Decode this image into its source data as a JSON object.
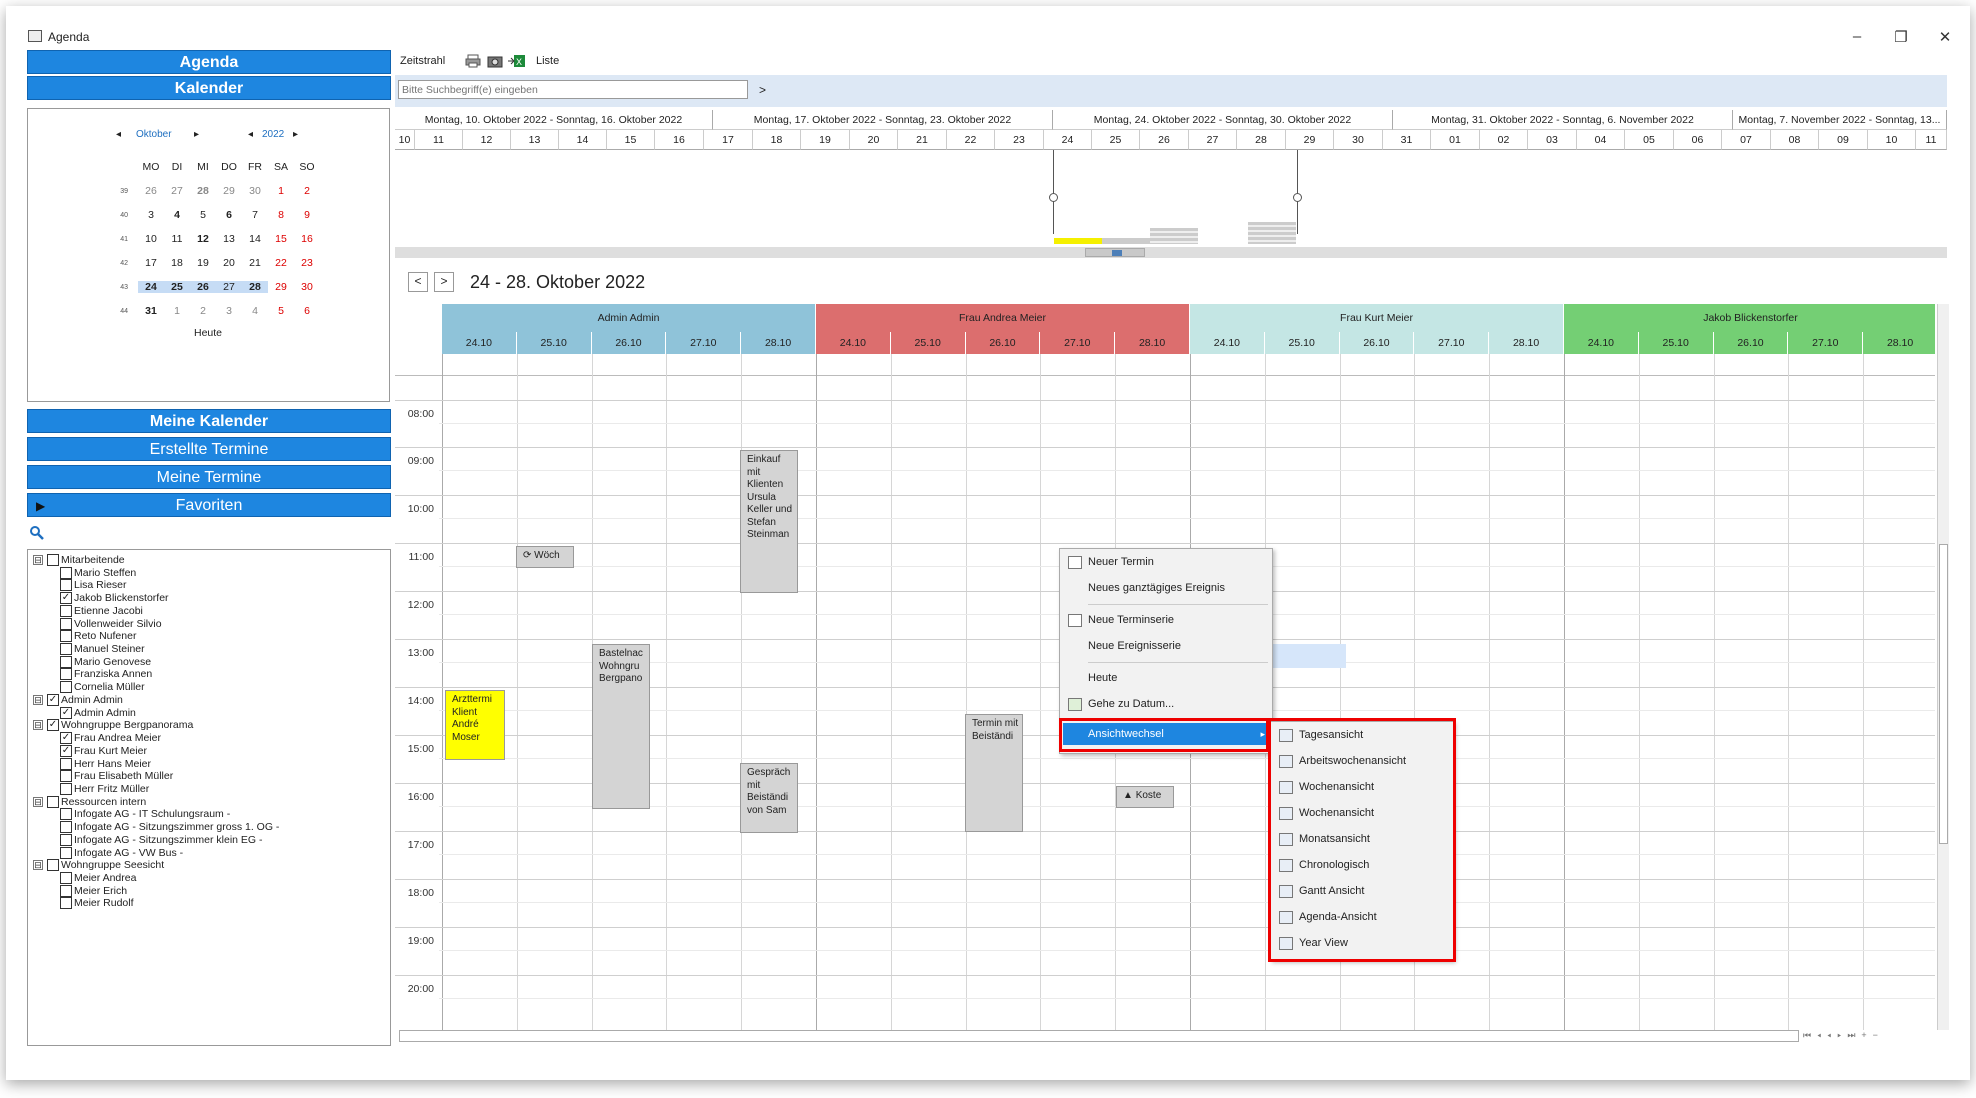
{
  "window": {
    "title": "Agenda",
    "minimize": "–",
    "restore": "❐",
    "close": "✕"
  },
  "sidebar": {
    "agenda": "Agenda",
    "kalender": "Kalender",
    "meine_kalender": "Meine Kalender",
    "erstellte_termine": "Erstellte Termine",
    "meine_termine": "Meine Termine",
    "favoriten": "Favoriten"
  },
  "minical": {
    "month": "Oktober",
    "year": "2022",
    "weekdays": [
      "MO",
      "DI",
      "MI",
      "DO",
      "FR",
      "SA",
      "SO"
    ],
    "weeks": [
      {
        "wk": "39",
        "days": [
          "26",
          "27",
          "28",
          "29",
          "30",
          "1",
          "2"
        ]
      },
      {
        "wk": "40",
        "days": [
          "3",
          "4",
          "5",
          "6",
          "7",
          "8",
          "9"
        ]
      },
      {
        "wk": "41",
        "days": [
          "10",
          "11",
          "12",
          "13",
          "14",
          "15",
          "16"
        ]
      },
      {
        "wk": "42",
        "days": [
          "17",
          "18",
          "19",
          "20",
          "21",
          "22",
          "23"
        ]
      },
      {
        "wk": "43",
        "days": [
          "24",
          "25",
          "26",
          "27",
          "28",
          "29",
          "30"
        ]
      },
      {
        "wk": "44",
        "days": [
          "31",
          "1",
          "2",
          "3",
          "4",
          "5",
          "6"
        ]
      }
    ],
    "today": "Heute"
  },
  "tree": [
    {
      "label": "Mitarbeitende",
      "level": 0,
      "checked": false,
      "exp": "⊟"
    },
    {
      "label": "Mario Steffen",
      "level": 1,
      "checked": false
    },
    {
      "label": "Lisa Rieser",
      "level": 1,
      "checked": false
    },
    {
      "label": "Jakob Blickenstorfer",
      "level": 1,
      "checked": true
    },
    {
      "label": "Etienne Jacobi",
      "level": 1,
      "checked": false
    },
    {
      "label": "Vollenweider Silvio",
      "level": 1,
      "checked": false
    },
    {
      "label": "Reto Nufener",
      "level": 1,
      "checked": false
    },
    {
      "label": "Manuel Steiner",
      "level": 1,
      "checked": false
    },
    {
      "label": "Mario Genovese",
      "level": 1,
      "checked": false
    },
    {
      "label": "Franziska Annen",
      "level": 1,
      "checked": false
    },
    {
      "label": "Cornelia Müller",
      "level": 1,
      "checked": false
    },
    {
      "label": "Admin Admin",
      "level": 0,
      "checked": true,
      "exp": "⊟"
    },
    {
      "label": "Admin Admin",
      "level": 1,
      "checked": true
    },
    {
      "label": "Wohngruppe Bergpanorama",
      "level": 0,
      "checked": true,
      "exp": "⊟"
    },
    {
      "label": "Frau Andrea Meier",
      "level": 1,
      "checked": true
    },
    {
      "label": "Frau Kurt Meier",
      "level": 1,
      "checked": true
    },
    {
      "label": "Herr Hans Meier",
      "level": 1,
      "checked": false
    },
    {
      "label": "Frau Elisabeth Müller",
      "level": 1,
      "checked": false
    },
    {
      "label": "Herr Fritz Müller",
      "level": 1,
      "checked": false
    },
    {
      "label": "Ressourcen intern",
      "level": 0,
      "checked": false,
      "exp": "⊟"
    },
    {
      "label": "Infogate AG -  IT Schulungsraum -",
      "level": 1,
      "checked": false
    },
    {
      "label": "Infogate AG -  Sitzungszimmer gross 1. OG -",
      "level": 1,
      "checked": false
    },
    {
      "label": "Infogate AG -  Sitzungszimmer klein EG -",
      "level": 1,
      "checked": false
    },
    {
      "label": "Infogate AG -  VW Bus -",
      "level": 1,
      "checked": false
    },
    {
      "label": "Wohngruppe Seesicht",
      "level": 0,
      "checked": false,
      "exp": "⊟"
    },
    {
      "label": "Meier Andrea",
      "level": 1,
      "checked": false
    },
    {
      "label": "Meier Erich",
      "level": 1,
      "checked": false
    },
    {
      "label": "Meier Rudolf",
      "level": 1,
      "checked": false
    }
  ],
  "toolbar": {
    "zeitstrahl": "Zeitstrahl",
    "liste": "Liste"
  },
  "search": {
    "placeholder": "Bitte Suchbegriff(e) eingeben",
    "go": ">"
  },
  "timeline": {
    "weeks": [
      "Montag, 10. Oktober 2022 - Sonntag, 16. Oktober 2022",
      "Montag, 17. Oktober 2022 - Sonntag, 23. Oktober 2022",
      "Montag, 24. Oktober 2022 - Sonntag, 30. Oktober 2022",
      "Montag, 31. Oktober 2022 - Sonntag, 6. November 2022",
      "Montag, 7. November 2022 - Sonntag, 13..."
    ],
    "days": [
      "10",
      "11",
      "12",
      "13",
      "14",
      "15",
      "16",
      "17",
      "18",
      "19",
      "20",
      "21",
      "22",
      "23",
      "24",
      "25",
      "26",
      "27",
      "28",
      "29",
      "30",
      "31",
      "01",
      "02",
      "03",
      "04",
      "05",
      "06",
      "07",
      "08",
      "09",
      "10",
      "11"
    ]
  },
  "view": {
    "range": "24 - 28. Oktober 2022",
    "prev": "<",
    "next": ">"
  },
  "groups": [
    {
      "name": "Admin Admin",
      "color": "#8fc3d9",
      "daycolor": "#8fc3d9"
    },
    {
      "name": "Frau Andrea Meier",
      "color": "#dc6e6e",
      "daycolor": "#dc6e6e"
    },
    {
      "name": "Frau Kurt Meier",
      "color": "#c4e6e4",
      "daycolor": "#c4e6e4"
    },
    {
      "name": "Jakob Blickenstorfer",
      "color": "#74cf74",
      "daycolor": "#74cf74"
    }
  ],
  "days": [
    "24.10",
    "25.10",
    "26.10",
    "27.10",
    "28.10"
  ],
  "hours": [
    "08:00",
    "09:00",
    "10:00",
    "11:00",
    "12:00",
    "13:00",
    "14:00",
    "15:00",
    "16:00",
    "17:00",
    "18:00",
    "19:00",
    "20:00"
  ],
  "appointments": {
    "einkauf": "Einkauf mit Klienten Ursula Keller und Stefan Steinman",
    "woech": "Wöch",
    "bastel": "Bastelnac Wohngru Bergpano",
    "arzt": "Arzttermi Klient André Moser",
    "termin": "Termin mit Beiständi",
    "gespraech": "Gespräch mit Beiständi von Sam",
    "koste": "Koste"
  },
  "context_menu": {
    "neuer_termin": "Neuer Termin",
    "ganztaegig": "Neues ganztägiges Ereignis",
    "terminserie": "Neue Terminserie",
    "ereignisserie": "Neue Ereignisserie",
    "heute": "Heute",
    "gehe_zu": "Gehe zu Datum...",
    "ansichtswechsel": "Ansichtwechsel"
  },
  "submenu": [
    "Tagesansicht",
    "Arbeitswochenansicht",
    "Wochenansicht",
    "Wochenansicht",
    "Monatsansicht",
    "Chronologisch",
    "Gantt Ansicht",
    "Agenda-Ansicht",
    "Year View"
  ],
  "colors": {
    "accent": "#1e86e0",
    "highlight_red": "#e00000",
    "appt_gray": "#d4d4d4",
    "appt_yellow": "#ffff00"
  }
}
